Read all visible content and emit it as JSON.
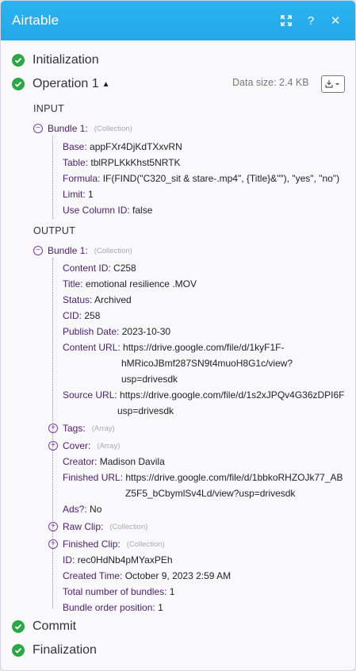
{
  "header": {
    "title": "Airtable"
  },
  "stages": {
    "initialization": "Initialization",
    "operation": "Operation 1",
    "commit": "Commit",
    "finalization": "Finalization"
  },
  "data_size": "Data size: 2.4 KB",
  "input": {
    "label": "INPUT",
    "bundle": "Bundle 1:",
    "bundle_tag": "(Collection)",
    "fields": [
      {
        "k": "Base:",
        "v": "appFXr4DjKdTXxvRN"
      },
      {
        "k": "Table:",
        "v": "tblRPLKkKhst5NRTK"
      },
      {
        "k": "Formula:",
        "v": "IF(FIND(\"C320_sit & stare-.mp4\", {Title}&\"\"), \"yes\", \"no\")"
      },
      {
        "k": "Limit:",
        "v": "1"
      },
      {
        "k": "Use Column ID:",
        "v": "false"
      }
    ]
  },
  "output": {
    "label": "OUTPUT",
    "bundle": "Bundle 1:",
    "bundle_tag": "(Collection)",
    "content_id": {
      "k": "Content ID:",
      "v": "C258"
    },
    "title": {
      "k": "Title:",
      "v": "emotional resilience .MOV"
    },
    "status": {
      "k": "Status:",
      "v": "Archived"
    },
    "cid": {
      "k": "CID:",
      "v": "258"
    },
    "publish_date": {
      "k": "Publish Date:",
      "v": "2023-10-30"
    },
    "content_url": {
      "k": "Content URL:",
      "v1": "https://drive.google.com/file/d/1kyF1F-",
      "v2": "hMRicoJBmf287SN9t4muoH8G1c/view?",
      "v3": "usp=drivesdk"
    },
    "source_url": {
      "k": "Source URL:",
      "v1": "https://drive.google.com/file/d/1s2xJPQv4G36zDPI6F",
      "v2": "usp=drivesdk"
    },
    "tags": {
      "k": "Tags:",
      "tag": "(Array)"
    },
    "cover": {
      "k": "Cover:",
      "tag": "(Array)"
    },
    "creator": {
      "k": "Creator:",
      "v": "Madison Davila"
    },
    "finished_url": {
      "k": "Finished URL:",
      "v1": "https://drive.google.com/file/d/1bbkoRHZOJk77_AB",
      "v2": "Z5F5_bCbymlSv4Ld/view?usp=drivesdk"
    },
    "ads": {
      "k": "Ads?:",
      "v": "No"
    },
    "raw_clip": {
      "k": "Raw Clip:",
      "tag": "(Collection)"
    },
    "finished_clip": {
      "k": "Finished Clip:",
      "tag": "(Collection)"
    },
    "id": {
      "k": "ID:",
      "v": "rec0HdNb4pMYaxPEh"
    },
    "created_time": {
      "k": "Created Time:",
      "v": "October 9, 2023 2:59 AM"
    },
    "total_bundles": {
      "k": "Total number of bundles:",
      "v": "1"
    },
    "bundle_order": {
      "k": "Bundle order position:",
      "v": "1"
    }
  },
  "icons": [
    "expand-icon",
    "help-icon",
    "close-icon",
    "check-icon",
    "caret-up-icon",
    "download-icon"
  ],
  "colors": {
    "header": "#26abec",
    "success": "#2aa846",
    "key": "#4a1e6b",
    "toggle": "#7a3ea6"
  }
}
